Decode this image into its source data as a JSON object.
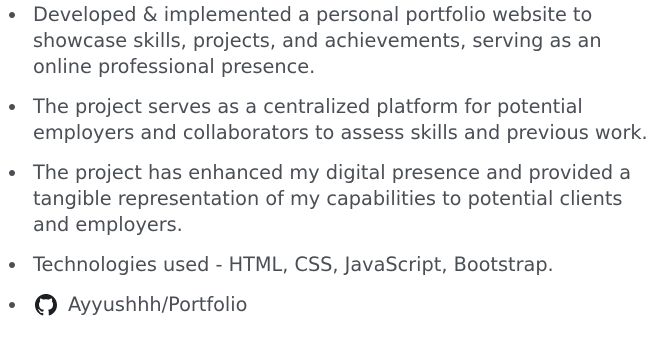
{
  "project": {
    "bullets": [
      {
        "text": "Developed & implemented a personal portfolio website to showcase skills, projects, and achievements, serving as an online professional presence."
      },
      {
        "text": "The project serves as a centralized platform for potential employers and collaborators to assess skills and previous work."
      },
      {
        "text": "The project has enhanced my digital presence and provided a tangible representation of my capabilities to potential clients and employers."
      },
      {
        "text": "Technologies used - HTML, CSS, JavaScript, Bootstrap."
      }
    ],
    "repo": {
      "icon": "github-icon",
      "label": "Ayyushhh/Portfolio"
    }
  },
  "colors": {
    "text": "#4a4f55",
    "background": "#ffffff"
  }
}
